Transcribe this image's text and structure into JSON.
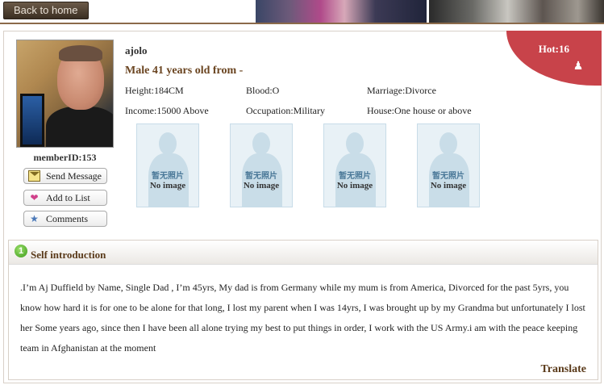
{
  "topbar": {
    "back_label": "Back to home"
  },
  "profile": {
    "hot_label": "Hot:16",
    "hot_icon": "person-badge-icon",
    "username": "ajolo",
    "headline": "Male 41 years old from -",
    "member_id": "memberID:153",
    "details": {
      "height": "Height:184CM",
      "blood": "Blood:O",
      "marriage": "Marriage:Divorce",
      "income": "Income:15000 Above",
      "occupation": "Occupation:Military",
      "house": "House:One house or above"
    },
    "actions": {
      "send_message": "Send Message",
      "add_to_list": "Add to List",
      "comments": "Comments"
    },
    "photos": [
      {
        "cn": "暂无照片",
        "en": "No image"
      },
      {
        "cn": "暂无照片",
        "en": "No image"
      },
      {
        "cn": "暂无照片",
        "en": "No image"
      },
      {
        "cn": "暂无照片",
        "en": "No image"
      }
    ]
  },
  "intro": {
    "icon_text": "1",
    "title": "Self introduction",
    "body": ".I’m Aj Duffield by Name, Single Dad , I’m 45yrs, My dad is from Germany while my mum is from America, Divorced for the past 5yrs, you know how hard it is for one to be alone for that long, I lost my parent when I was 14yrs, I was brought up by my Grandma but unfortunately I lost her Some years ago, since then I have been all alone trying my best to put things in order, I work with the US Army.i am with the peace keeping team in Afghanistan at the moment",
    "translate_label": "Translate"
  },
  "colors": {
    "accent_red": "#c8434a",
    "heading_brown": "#6a4420",
    "back_button": "#3a2e22"
  }
}
